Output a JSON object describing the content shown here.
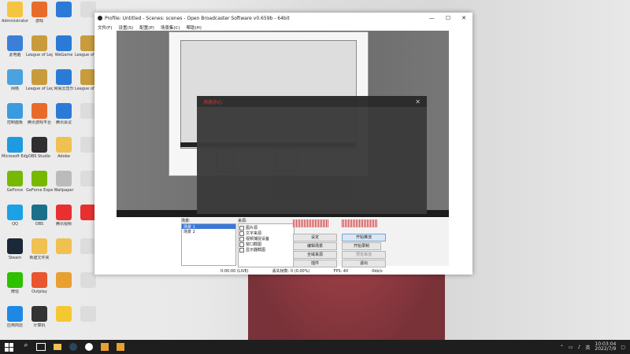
{
  "desktop_icons": [
    {
      "label": "Administrator",
      "col": 0,
      "row": 0,
      "color": "#f5c542"
    },
    {
      "label": "此电脑",
      "col": 0,
      "row": 1,
      "color": "#3b7fd9"
    },
    {
      "label": "网络",
      "col": 0,
      "row": 2,
      "color": "#4aa3df"
    },
    {
      "label": "控制面板",
      "col": 0,
      "row": 3,
      "color": "#3b9be0"
    },
    {
      "label": "Microsoft Edge",
      "col": 0,
      "row": 4,
      "color": "#1e9be0"
    },
    {
      "label": "GeForce",
      "col": 0,
      "row": 5,
      "color": "#76b900"
    },
    {
      "label": "QQ",
      "col": 0,
      "row": 6,
      "color": "#1aa1e6"
    },
    {
      "label": "Steam",
      "col": 0,
      "row": 7,
      "color": "#1b2838"
    },
    {
      "label": "微信",
      "col": 0,
      "row": 8,
      "color": "#2dc100"
    },
    {
      "label": "应用商店",
      "col": 0,
      "row": 9,
      "color": "#1e88e5"
    },
    {
      "label": "游戏",
      "col": 1,
      "row": 0,
      "color": "#e96b2a"
    },
    {
      "label": "League of Legends",
      "col": 1,
      "row": 1,
      "color": "#c89b3c"
    },
    {
      "label": "League of Legends",
      "col": 1,
      "row": 2,
      "color": "#c89b3c"
    },
    {
      "label": "腾讯游戏平台",
      "col": 1,
      "row": 3,
      "color": "#e96b2a"
    },
    {
      "label": "OBS Studio",
      "col": 1,
      "row": 4,
      "color": "#302e31"
    },
    {
      "label": "GeForce Experience",
      "col": 1,
      "row": 5,
      "color": "#76b900"
    },
    {
      "label": "OBS",
      "col": 1,
      "row": 6,
      "color": "#1b6f8a"
    },
    {
      "label": "新建文件夹",
      "col": 1,
      "row": 7,
      "color": "#f0c050"
    },
    {
      "label": "Outplay",
      "col": 1,
      "row": 8,
      "color": "#e8572f"
    },
    {
      "label": "计算机",
      "col": 1,
      "row": 9,
      "color": "#333"
    },
    {
      "label": "",
      "col": 2,
      "row": 0,
      "color": "#2b7bd6"
    },
    {
      "label": "WeGame",
      "col": 2,
      "row": 1,
      "color": "#2b7bd6"
    },
    {
      "label": "网易云音乐",
      "col": 2,
      "row": 2,
      "color": "#2b7bd6"
    },
    {
      "label": "腾讯会议",
      "col": 2,
      "row": 3,
      "color": "#2b7bd6"
    },
    {
      "label": "Adobe",
      "col": 2,
      "row": 4,
      "color": "#f0c050"
    },
    {
      "label": "Wallpaper",
      "col": 2,
      "row": 5,
      "color": "#bbb"
    },
    {
      "label": "腾讯视频",
      "col": 2,
      "row": 6,
      "color": "#e83030"
    },
    {
      "label": "",
      "col": 2,
      "row": 7,
      "color": "#f0c050"
    },
    {
      "label": "",
      "col": 2,
      "row": 8,
      "color": "#e8a030"
    },
    {
      "label": "",
      "col": 2,
      "row": 9,
      "color": "#f4c830"
    },
    {
      "label": "",
      "col": 3,
      "row": 0,
      "color": "#dcdcdc"
    },
    {
      "label": "League of Legends",
      "col": 3,
      "row": 1,
      "color": "#c89b3c"
    },
    {
      "label": "League of Legends",
      "col": 3,
      "row": 2,
      "color": "#c89b3c"
    },
    {
      "label": "",
      "col": 3,
      "row": 3,
      "color": "#dcdcdc"
    },
    {
      "label": "",
      "col": 3,
      "row": 4,
      "color": "#dcdcdc"
    },
    {
      "label": "",
      "col": 3,
      "row": 5,
      "color": "#dcdcdc"
    },
    {
      "label": "",
      "col": 3,
      "row": 6,
      "color": "#e83030"
    },
    {
      "label": "",
      "col": 3,
      "row": 7,
      "color": "#dcdcdc"
    },
    {
      "label": "",
      "col": 3,
      "row": 8,
      "color": "#dcdcdc"
    },
    {
      "label": "",
      "col": 3,
      "row": 9,
      "color": "#dcdcdc"
    }
  ],
  "obs": {
    "title": "Profile: Untitled - Scenes: scenes - Open Broadcaster Software v0.659b - 64bit",
    "menus": [
      "文件(F)",
      "设置(S)",
      "配置(P)",
      "场景集(C)",
      "帮助(H)"
    ],
    "scenes_label": "场景:",
    "scene_items": [
      "场景 1",
      "场景 2"
    ],
    "sources_label": "来源:",
    "sources": [
      "图片源",
      "文字来源",
      "视频捕捉设备",
      "窗口截图",
      "显示器截图"
    ],
    "buttons": {
      "settings": "设定",
      "start_stream": "开始推流",
      "edit_scene": "编辑场景",
      "start_record": "开始录制",
      "global_sources": "全域来源",
      "preview": "预览串流",
      "plugins": "插件",
      "exit": "退出"
    },
    "status": {
      "time": "0:00:00 (LIVE)",
      "dropped": "丢失帧数: 0 (0.00%)",
      "fps": "FPS: 40",
      "bitrate": "0kb/s"
    },
    "dialog_title": "消息中心"
  },
  "taskbar": {
    "time": "10:03:04",
    "date": "2022/7/9",
    "lang": "英"
  }
}
